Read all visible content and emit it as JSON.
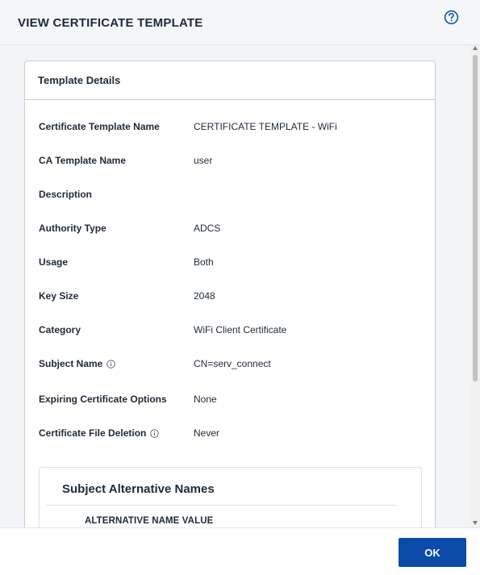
{
  "dialog": {
    "title": "VIEW CERTIFICATE TEMPLATE",
    "help_icon": "question-circle-icon"
  },
  "card": {
    "title": "Template Details",
    "rows": [
      {
        "label": "Certificate Template Name",
        "value": "CERTIFICATE TEMPLATE - WiFi"
      },
      {
        "label": "CA Template Name",
        "value": "user"
      },
      {
        "label": "Description",
        "value": ""
      },
      {
        "label": "Authority Type",
        "value": "ADCS"
      },
      {
        "label": "Usage",
        "value": "Both"
      },
      {
        "label": "Key Size",
        "value": "2048"
      },
      {
        "label": "Category",
        "value": "WiFi Client Certificate"
      },
      {
        "label": "Subject Name",
        "value": "CN=serv_connect",
        "info_icon": "info-circle-icon"
      },
      {
        "label": "Expiring Certificate Options",
        "value": "None"
      },
      {
        "label": "Certificate File Deletion",
        "value": "Never",
        "info_icon": "info-circle-icon"
      }
    ]
  },
  "san": {
    "title": "Subject Alternative Names",
    "column_header": "ALTERNATIVE NAME VALUE"
  },
  "footer": {
    "ok_label": "OK"
  },
  "colors": {
    "primary": "#0a4ba8",
    "header_bg": "#f5f6f8",
    "body_bg": "#f3f4f6"
  }
}
